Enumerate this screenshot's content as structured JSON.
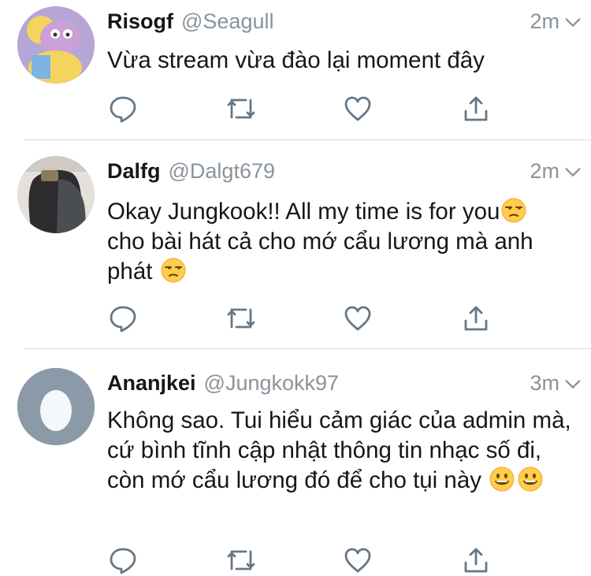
{
  "tweets": [
    {
      "name": "Risogf",
      "handle": "@Seagull",
      "time": "2m",
      "text": "Vừa stream vừa đào lại moment đây"
    },
    {
      "name": "Dalfg",
      "handle": "@Dalgt679",
      "time": "2m",
      "text_part1": "Okay Jungkook!! All my time is for you",
      "text_part2": " cho bài hát cả cho mớ cẩu lương mà anh phát ",
      "emoji": "unamused-face"
    },
    {
      "name": "Ananjkei",
      "handle": "@Jungkokk97",
      "time": "3m",
      "text": "Không sao. Tui hiểu cảm giác của admin mà, cứ bình tĩnh cập nhật thông tin nhạc số đi, còn mớ cẩu lương đó để cho tụi này ",
      "emoji": "grinning-face"
    }
  ],
  "icons": [
    "reply-icon",
    "retweet-icon",
    "like-icon",
    "share-icon",
    "chevron-down-icon"
  ],
  "colors": {
    "icon_gray": "#657786",
    "secondary_text": "#8a939b",
    "divider": "#d6dade",
    "default_avatar_bg": "#8a9aa8"
  }
}
